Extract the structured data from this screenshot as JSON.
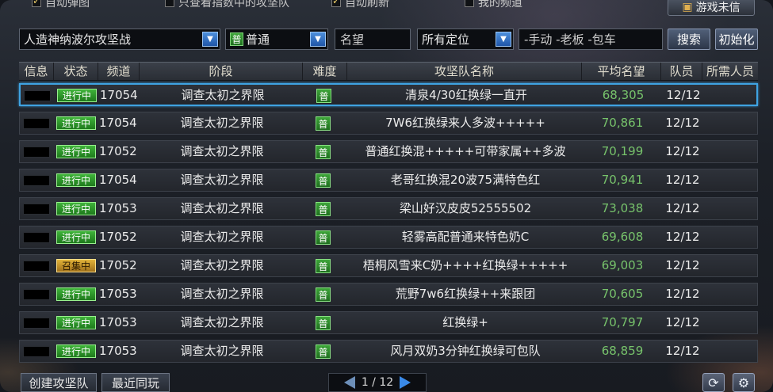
{
  "options": {
    "auto_map": "自动弹图",
    "only_selected_contains": "只查看指数中的攻坚队",
    "auto_refresh": "自动刷新",
    "my_channel": "我的频道",
    "game_button": "游戏未信"
  },
  "filters": {
    "dungeon": "人造神纳波尔攻坚战",
    "difficulty_tag": "普",
    "difficulty": "普通",
    "fame_placeholder": "名望",
    "position": "所有定位",
    "keyword": "-手动 -老板 -包车",
    "search_label": "搜索",
    "reset_label": "初始化"
  },
  "columns": [
    "信息",
    "状态",
    "频道",
    "阶段",
    "难度",
    "攻坚队名称",
    "平均名望",
    "队员",
    "所需人员"
  ],
  "rows": [
    {
      "status": "进行中",
      "channel": "17054",
      "stage": "调查太初之界限",
      "difficulty": "普",
      "name": "清泉4/30红换绿一直开",
      "fame": "68,305",
      "members": "12/12"
    },
    {
      "status": "进行中",
      "channel": "17054",
      "stage": "调查太初之界限",
      "difficulty": "普",
      "name": "7W6红换绿来人多波+++++",
      "fame": "70,861",
      "members": "12/12"
    },
    {
      "status": "进行中",
      "channel": "17052",
      "stage": "调查太初之界限",
      "difficulty": "普",
      "name": "普通红换混+++++可带家属++多波",
      "fame": "70,199",
      "members": "12/12"
    },
    {
      "status": "进行中",
      "channel": "17054",
      "stage": "调查太初之界限",
      "difficulty": "普",
      "name": "老哥红换混20波75满特色红",
      "fame": "70,941",
      "members": "12/12"
    },
    {
      "status": "进行中",
      "channel": "17053",
      "stage": "调查太初之界限",
      "difficulty": "普",
      "name": "梁山好汉皮皮52555502",
      "fame": "73,038",
      "members": "12/12"
    },
    {
      "status": "进行中",
      "channel": "17052",
      "stage": "调查太初之界限",
      "difficulty": "普",
      "name": "轻雾高配普通来特色奶C",
      "fame": "69,608",
      "members": "12/12"
    },
    {
      "status": "召集中",
      "channel": "17052",
      "stage": "调查太初之界限",
      "difficulty": "普",
      "name": "梧桐风雪来C奶++++红换绿+++++",
      "fame": "69,003",
      "members": "12/12"
    },
    {
      "status": "进行中",
      "channel": "17053",
      "stage": "调查太初之界限",
      "difficulty": "普",
      "name": "荒野7w6红换绿++来跟团",
      "fame": "70,605",
      "members": "12/12"
    },
    {
      "status": "进行中",
      "channel": "17053",
      "stage": "调查太初之界限",
      "difficulty": "普",
      "name": "红换绿+",
      "fame": "70,797",
      "members": "12/12"
    },
    {
      "status": "进行中",
      "channel": "17053",
      "stage": "调查太初之界限",
      "difficulty": "普",
      "name": "风月双奶3分钟红换绿可包队",
      "fame": "68,859",
      "members": "12/12"
    }
  ],
  "footer": {
    "create_label": "创建攻坚队",
    "recent_label": "最近同玩",
    "page": "1 / 12"
  }
}
